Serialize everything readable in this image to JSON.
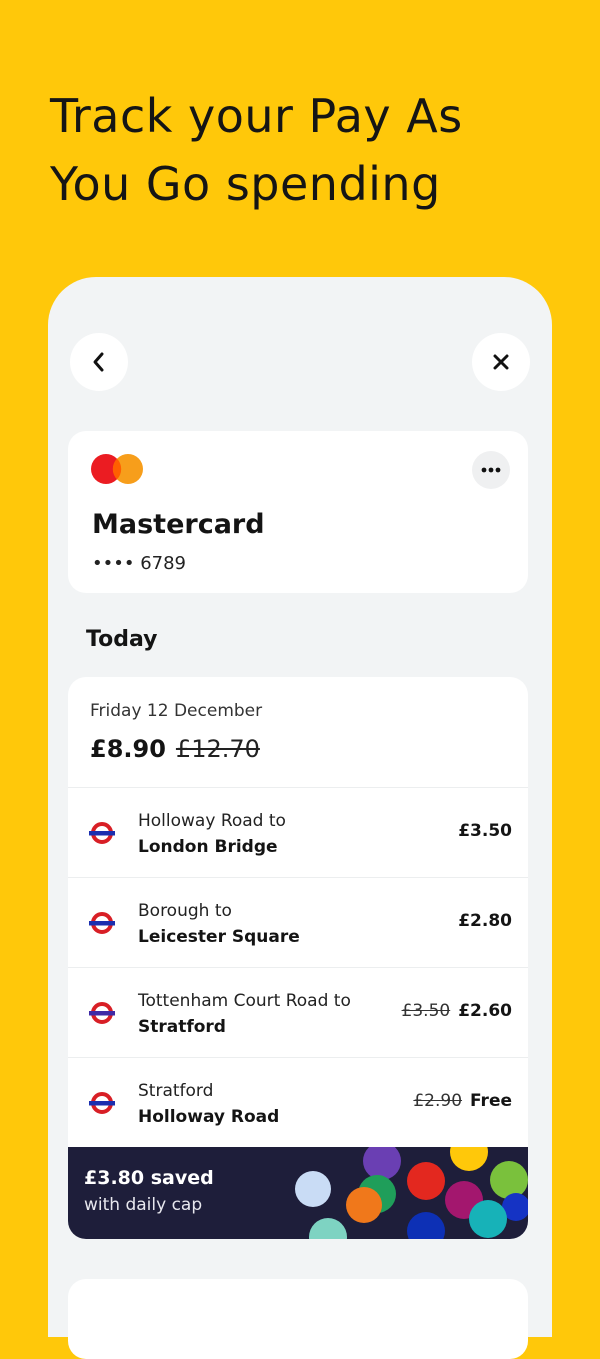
{
  "headline": {
    "line1": "Track your Pay As",
    "line2": "You Go spending"
  },
  "nav": {
    "back_icon": "chevron-left-icon",
    "close_icon": "close-icon"
  },
  "payment_card": {
    "brand": "Mastercard",
    "masked_number": "•••• 6789",
    "more_icon": "more-horizontal-icon"
  },
  "section": {
    "title": "Today"
  },
  "day": {
    "date": "Friday 12 December",
    "total": "£8.90",
    "original_total": "£12.70"
  },
  "journeys": [
    {
      "from": "Holloway Road to",
      "to": "London Bridge",
      "original_price": "",
      "price": "£3.50",
      "line_color": "#1B2FB0"
    },
    {
      "from": "Borough to",
      "to": "Leicester Square",
      "original_price": "",
      "price": "£2.80",
      "line_color": "#1B2FB0"
    },
    {
      "from": "Tottenham Court Road to",
      "to": "Stratford",
      "original_price": "£3.50",
      "price": "£2.60",
      "line_color": "#3F2AA6"
    },
    {
      "from": "Stratford",
      "to": "Holloway Road",
      "original_price": "£2.90",
      "price": "Free",
      "line_color": "#1B2FB0"
    }
  ],
  "savings": {
    "amount": "£3.80 saved",
    "caption": "with daily cap"
  },
  "colors": {
    "background": "#FFC80A",
    "roundel_red": "#D81F26",
    "savings_bar": "#1E1E3A"
  }
}
